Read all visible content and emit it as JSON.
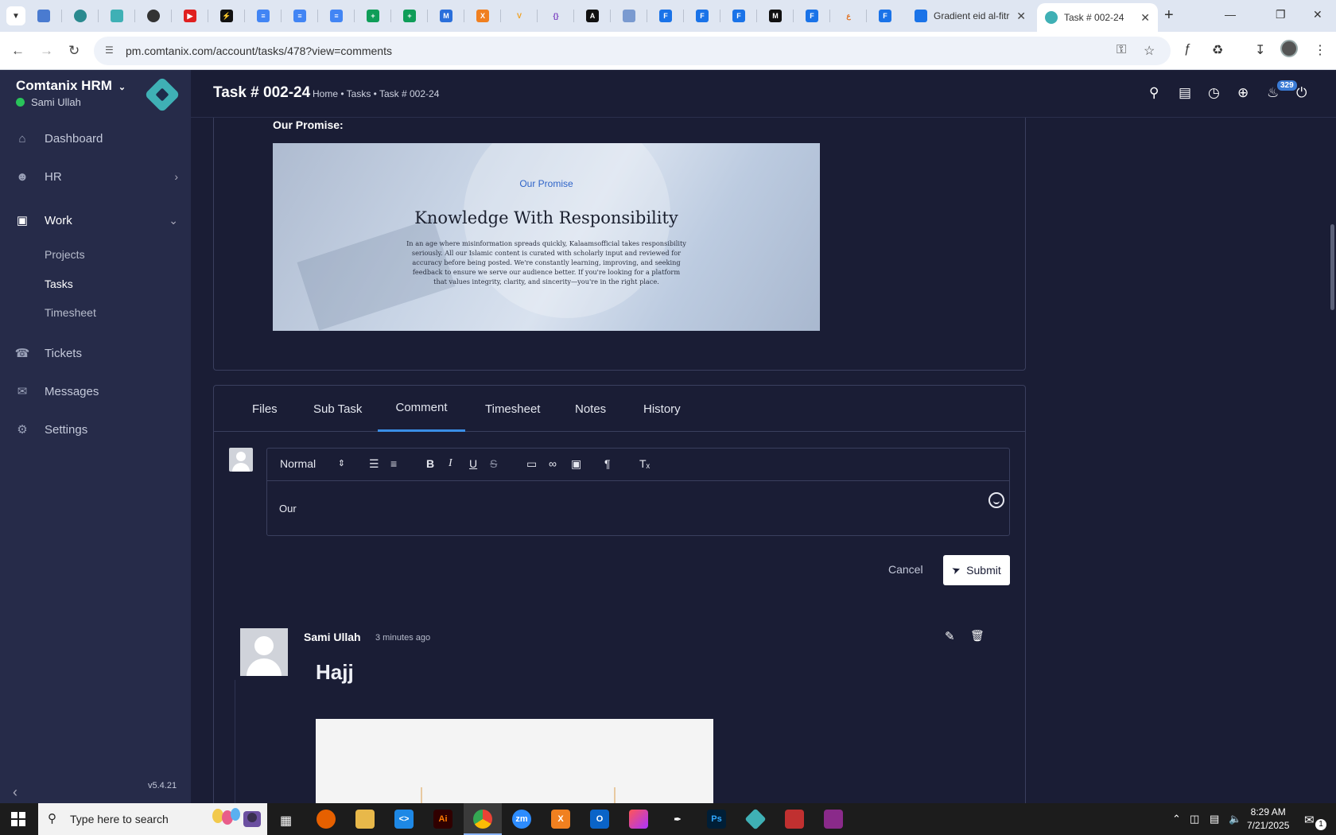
{
  "browser": {
    "tabs": [
      {
        "title": "Gradient eid al-fitr"
      },
      {
        "title": "Task # 002-24"
      }
    ],
    "url": "pm.comtanix.com/account/tasks/478?view=comments"
  },
  "app": {
    "brand": "Comtanix HRM",
    "user": "Sami Ullah",
    "version": "v5.4.21"
  },
  "sidebar": {
    "items": [
      {
        "label": "Dashboard",
        "icon": "home-icon"
      },
      {
        "label": "HR",
        "icon": "users-icon"
      },
      {
        "label": "Work",
        "icon": "briefcase-icon"
      },
      {
        "label": "Tickets",
        "icon": "headset-icon"
      },
      {
        "label": "Messages",
        "icon": "chat-icon"
      },
      {
        "label": "Settings",
        "icon": "gear-icon"
      }
    ],
    "work_sub": [
      {
        "label": "Projects"
      },
      {
        "label": "Tasks"
      },
      {
        "label": "Timesheet"
      }
    ]
  },
  "header": {
    "title": "Task # 002-24",
    "breadcrumb": "Home • Tasks • Task # 002-24",
    "notifications": "329"
  },
  "task": {
    "promise_label": "Our Promise:",
    "image": {
      "kicker": "Our Promise",
      "heading": "Knowledge With Responsibility",
      "body": "In an age where misinformation spreads quickly, Kalaamsofficial takes responsibility seriously. All our Islamic content is curated with scholarly input and reviewed for accuracy before being posted. We're constantly learning, improving, and seeking feedback to ensure we serve our audience better. If you're looking for a platform that values integrity, clarity, and sincerity—you're in the right place."
    }
  },
  "tabs": [
    {
      "label": "Files"
    },
    {
      "label": "Sub Task"
    },
    {
      "label": "Comment"
    },
    {
      "label": "Timesheet"
    },
    {
      "label": "Notes"
    },
    {
      "label": "History"
    }
  ],
  "editor": {
    "format": "Normal",
    "text": "Our",
    "cancel": "Cancel",
    "submit": "Submit"
  },
  "comment": {
    "author": "Sami Ullah",
    "time": "3 minutes ago",
    "title": "Hajj"
  },
  "taskbar": {
    "search_placeholder": "Type here to search",
    "time": "8:29 AM",
    "date": "7/21/2025",
    "notif": "1"
  }
}
